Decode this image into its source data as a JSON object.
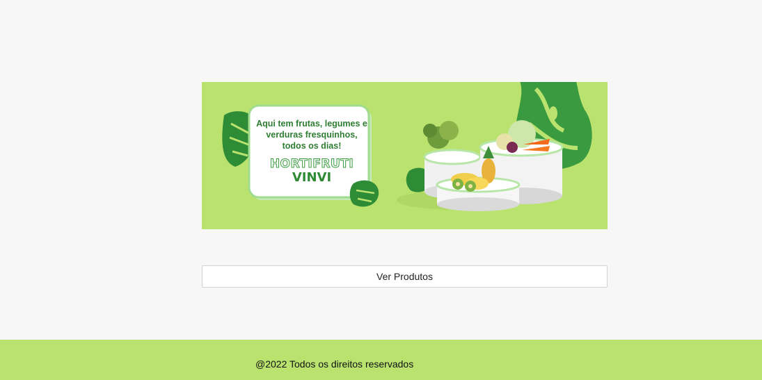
{
  "banner": {
    "tagline_line_1": "Aqui tem frutas, legumes e",
    "tagline_line_2": "verduras fresquinhos,",
    "tagline_line_3": "todos os dias!",
    "brand_line_1": "HORTIFRUTI",
    "brand_line_2": "VINVI"
  },
  "actions": {
    "ver_produtos_label": "Ver Produtos"
  },
  "footer": {
    "copyright": "@2022 Todos os direitos reservados"
  },
  "colors": {
    "accent_green": "#b9e26f",
    "dark_green": "#2f8a35",
    "page_background": "#f7f7f7"
  }
}
